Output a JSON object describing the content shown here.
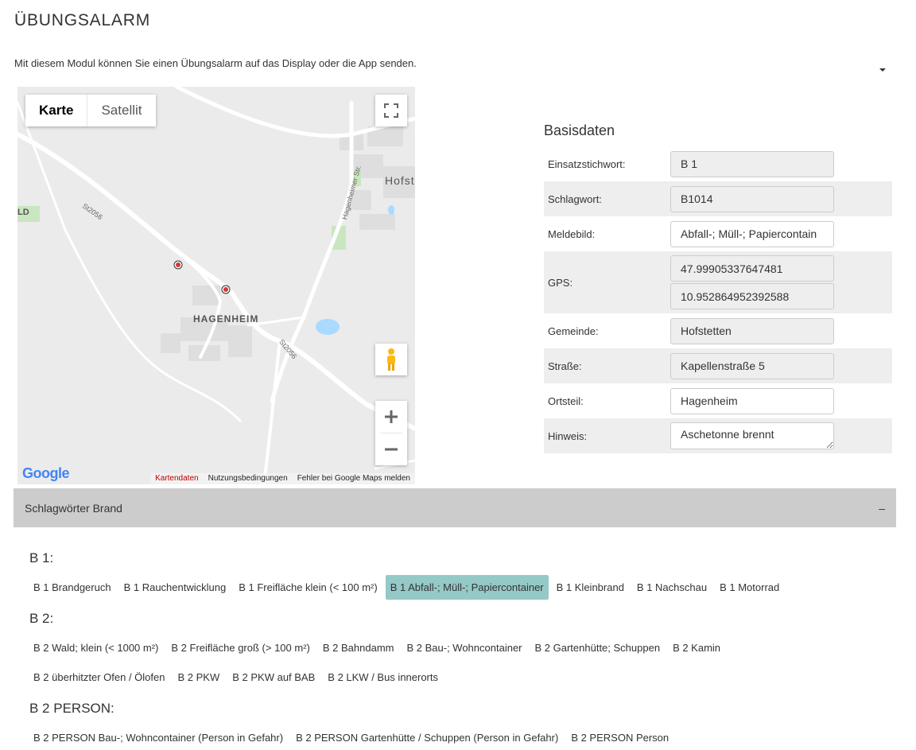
{
  "page": {
    "title": "ÜBUNGSALARM",
    "intro": "Mit diesem Modul können Sie einen Übungsalarm auf das Display oder die App senden."
  },
  "map": {
    "type_buttons": [
      "Karte",
      "Satellit"
    ],
    "labels": {
      "town": "HAGENHEIM",
      "place_right": "Hofst",
      "place_left": "LD",
      "road_1": "St2056",
      "road_2": "St2056",
      "street": "Hagenheimer Str."
    },
    "google": "Google",
    "footer": {
      "map_data": "Kartendaten",
      "terms": "Nutzungsbedingungen",
      "report": "Fehler bei Google Maps melden"
    },
    "icons": [
      "fullscreen-icon",
      "pegman-icon",
      "zoom-in-icon",
      "zoom-out-icon"
    ]
  },
  "form": {
    "title": "Basisdaten",
    "rows": [
      {
        "label": "Einsatzstichwort:",
        "values": [
          "B 1"
        ],
        "readonly": true
      },
      {
        "label": "Schlagwort:",
        "values": [
          "B1014"
        ],
        "readonly": true
      },
      {
        "label": "Meldebild:",
        "values": [
          "Abfall-; Müll-; Papiercontain"
        ],
        "readonly": false
      },
      {
        "label": "GPS:",
        "values": [
          "47.99905337647481",
          "10.952864952392588"
        ],
        "readonly": true
      },
      {
        "label": "Gemeinde:",
        "values": [
          "Hofstetten"
        ],
        "readonly": true
      },
      {
        "label": "Straße:",
        "values": [
          "Kapellenstraße 5"
        ],
        "readonly": true
      },
      {
        "label": "Ortsteil:",
        "values": [
          "Hagenheim"
        ],
        "readonly": false
      },
      {
        "label": "Hinweis:",
        "values": [
          "Aschetonne brennt"
        ],
        "readonly": false,
        "multiline": true
      }
    ]
  },
  "accordion": {
    "title": "Schlagwörter Brand",
    "toggle": "–"
  },
  "groups": [
    {
      "title": "B 1:",
      "rows": [
        [
          "B 1 Brandgeruch",
          "B 1 Rauchentwicklung",
          "B 1 Freifläche klein (< 100 m²)",
          "B 1 Abfall-; Müll-; Papiercontainer",
          "B 1 Kleinbrand",
          "B 1 Nachschau",
          "B 1 Motorrad"
        ]
      ]
    },
    {
      "title": "B 2:",
      "rows": [
        [
          "B 2 Wald; klein (< 1000 m²)",
          "B 2 Freifläche groß (> 100 m²)",
          "B 2 Bahndamm",
          "B 2 Bau-; Wohncontainer",
          "B 2 Gartenhütte; Schuppen",
          "B 2 Kamin"
        ],
        [
          "B 2 überhitzter Ofen / Ölofen",
          "B 2 PKW",
          "B 2 PKW auf BAB",
          "B 2 LKW / Bus innerorts"
        ]
      ]
    },
    {
      "title": "B 2 PERSON:",
      "rows": [
        [
          "B 2 PERSON Bau-; Wohncontainer (Person in Gefahr)",
          "B 2 PERSON Gartenhütte / Schuppen (Person in Gefahr)",
          "B 2 PERSON Person"
        ]
      ]
    }
  ],
  "selected_keyword": "B 1 Abfall-; Müll-; Papiercontainer",
  "colors": {
    "selected_chip": "#94c9c7",
    "accordion": "#cccccc",
    "readonly_field": "#eeeeee"
  }
}
